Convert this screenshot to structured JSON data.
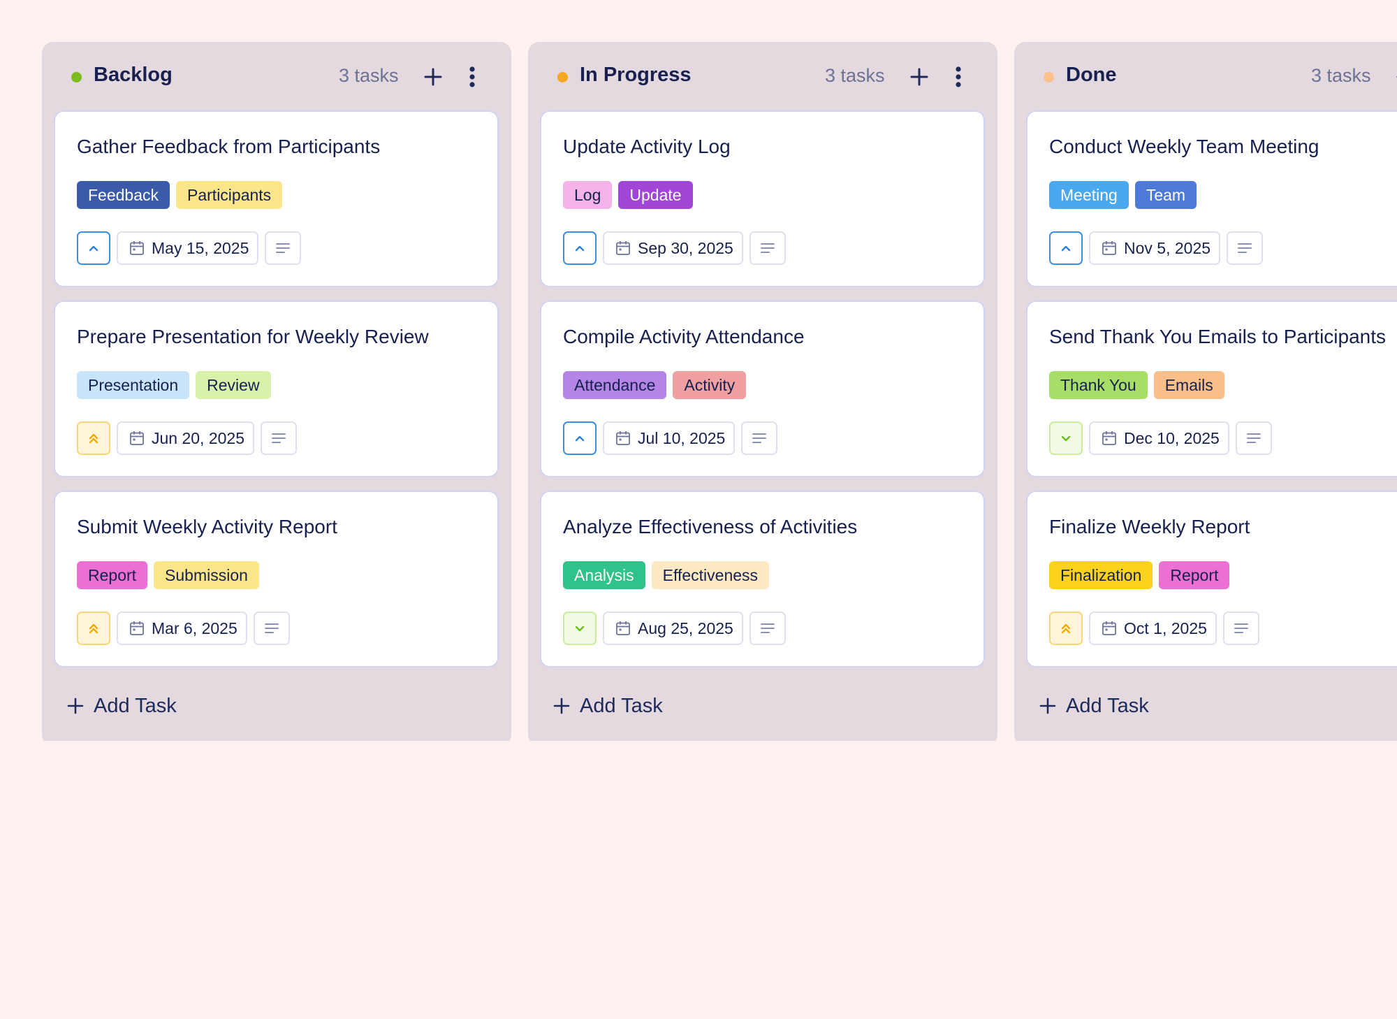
{
  "columns": [
    {
      "title": "Backlog",
      "count": "3 tasks",
      "dot_color": "#7dbb1e",
      "add_task_label": "Add Task",
      "cards": [
        {
          "title": "Gather Feedback from Participants",
          "tags": [
            {
              "label": "Feedback",
              "bg": "#3b5aa8",
              "fg": "#ffffff"
            },
            {
              "label": "Participants",
              "bg": "#fde68a",
              "fg": "#17204f"
            }
          ],
          "priority": "medium",
          "date": "May 15, 2025"
        },
        {
          "title": "Prepare Presentation for Weekly Review",
          "tags": [
            {
              "label": "Presentation",
              "bg": "#c8e4fa",
              "fg": "#17204f"
            },
            {
              "label": "Review",
              "bg": "#d9f2a9",
              "fg": "#17204f"
            }
          ],
          "priority": "high",
          "date": "Jun 20, 2025"
        },
        {
          "title": "Submit Weekly Activity Report",
          "tags": [
            {
              "label": "Report",
              "bg": "#ee6fd4",
              "fg": "#17204f"
            },
            {
              "label": "Submission",
              "bg": "#fde68a",
              "fg": "#17204f"
            }
          ],
          "priority": "high",
          "date": "Mar 6, 2025"
        }
      ]
    },
    {
      "title": "In Progress",
      "count": "3 tasks",
      "dot_color": "#f5a623",
      "add_task_label": "Add Task",
      "cards": [
        {
          "title": "Update Activity Log",
          "tags": [
            {
              "label": "Log",
              "bg": "#f5b3ea",
              "fg": "#17204f"
            },
            {
              "label": "Update",
              "bg": "#a146d6",
              "fg": "#ffffff"
            }
          ],
          "priority": "medium",
          "date": "Sep 30, 2025"
        },
        {
          "title": "Compile Activity Attendance",
          "tags": [
            {
              "label": "Attendance",
              "bg": "#b585e6",
              "fg": "#17204f"
            },
            {
              "label": "Activity",
              "bg": "#f0a0a0",
              "fg": "#17204f"
            }
          ],
          "priority": "medium",
          "date": "Jul 10, 2025"
        },
        {
          "title": "Analyze Effectiveness of Activities",
          "tags": [
            {
              "label": "Analysis",
              "bg": "#2fc28a",
              "fg": "#ffffff"
            },
            {
              "label": "Effectiveness",
              "bg": "#fde9c3",
              "fg": "#17204f"
            }
          ],
          "priority": "low",
          "date": "Aug 25, 2025"
        }
      ]
    },
    {
      "title": "Done",
      "count": "3 tasks",
      "dot_color": "#fbc08c",
      "add_task_label": "Add Task",
      "cards": [
        {
          "title": "Conduct Weekly Team Meeting",
          "tags": [
            {
              "label": "Meeting",
              "bg": "#4aa8f0",
              "fg": "#ffffff"
            },
            {
              "label": "Team",
              "bg": "#4d7ad8",
              "fg": "#ffffff"
            }
          ],
          "priority": "medium",
          "date": "Nov 5, 2025"
        },
        {
          "title": "Send Thank You Emails to Participants",
          "tags": [
            {
              "label": "Thank You",
              "bg": "#a8de68",
              "fg": "#17204f"
            },
            {
              "label": "Emails",
              "bg": "#fbbf8a",
              "fg": "#17204f"
            }
          ],
          "priority": "low",
          "date": "Dec 10, 2025"
        },
        {
          "title": "Finalize Weekly Report",
          "tags": [
            {
              "label": "Finalization",
              "bg": "#fcd21c",
              "fg": "#17204f"
            },
            {
              "label": "Report",
              "bg": "#ee6fd4",
              "fg": "#17204f"
            }
          ],
          "priority": "high",
          "date": "Oct 1, 2025"
        }
      ]
    }
  ],
  "priority_styles": {
    "medium": {
      "icon": "chevron-up-icon",
      "border": "#3b8fe0",
      "bg": "#ffffff",
      "color": "#2f7fd9"
    },
    "high": {
      "icon": "double-chevron-up-icon",
      "border": "#fcd57a",
      "bg": "#fff6d9",
      "color": "#f5a800"
    },
    "low": {
      "icon": "chevron-down-icon",
      "border": "#c9ed9c",
      "bg": "#f1fbe4",
      "color": "#6cbb1e"
    }
  },
  "icons": {
    "column_add": "plus-icon",
    "column_menu": "kebab-menu-icon",
    "date": "calendar-icon",
    "description": "description-lines-icon",
    "add_task": "plus-icon"
  }
}
